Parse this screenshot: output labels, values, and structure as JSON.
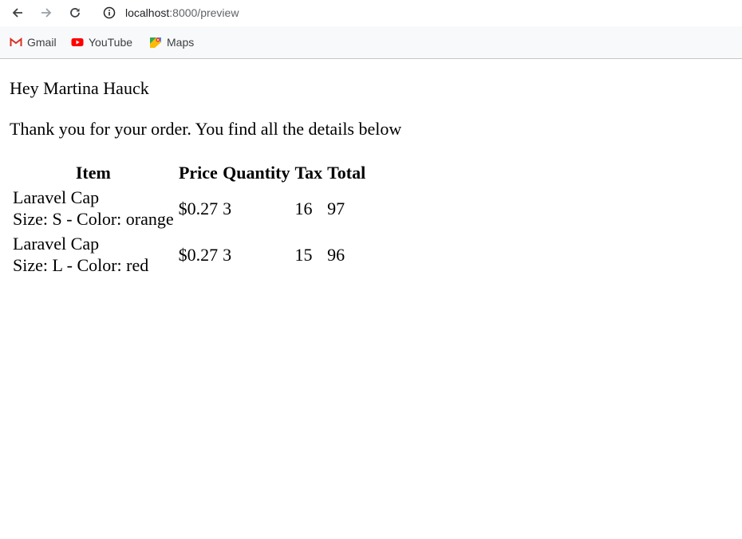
{
  "browser": {
    "url_host": "localhost",
    "url_path": ":8000/preview"
  },
  "bookmarks": [
    {
      "label": "Gmail",
      "icon": "gmail-icon"
    },
    {
      "label": "YouTube",
      "icon": "youtube-icon"
    },
    {
      "label": "Maps",
      "icon": "maps-icon"
    }
  ],
  "page": {
    "greeting": "Hey Martina Hauck",
    "intro": "Thank you for your order. You find all the details below",
    "table": {
      "headers": [
        "Item",
        "Price",
        "Quantity",
        "Tax",
        "Total"
      ],
      "rows": [
        {
          "item": "Laravel Cap",
          "variant": "Size: S - Color: orange",
          "price": "$0.27",
          "quantity": "3",
          "tax": "16",
          "total": "97"
        },
        {
          "item": "Laravel Cap",
          "variant": "Size: L - Color: red",
          "price": "$0.27",
          "quantity": "3",
          "tax": "15",
          "total": "96"
        }
      ]
    }
  }
}
